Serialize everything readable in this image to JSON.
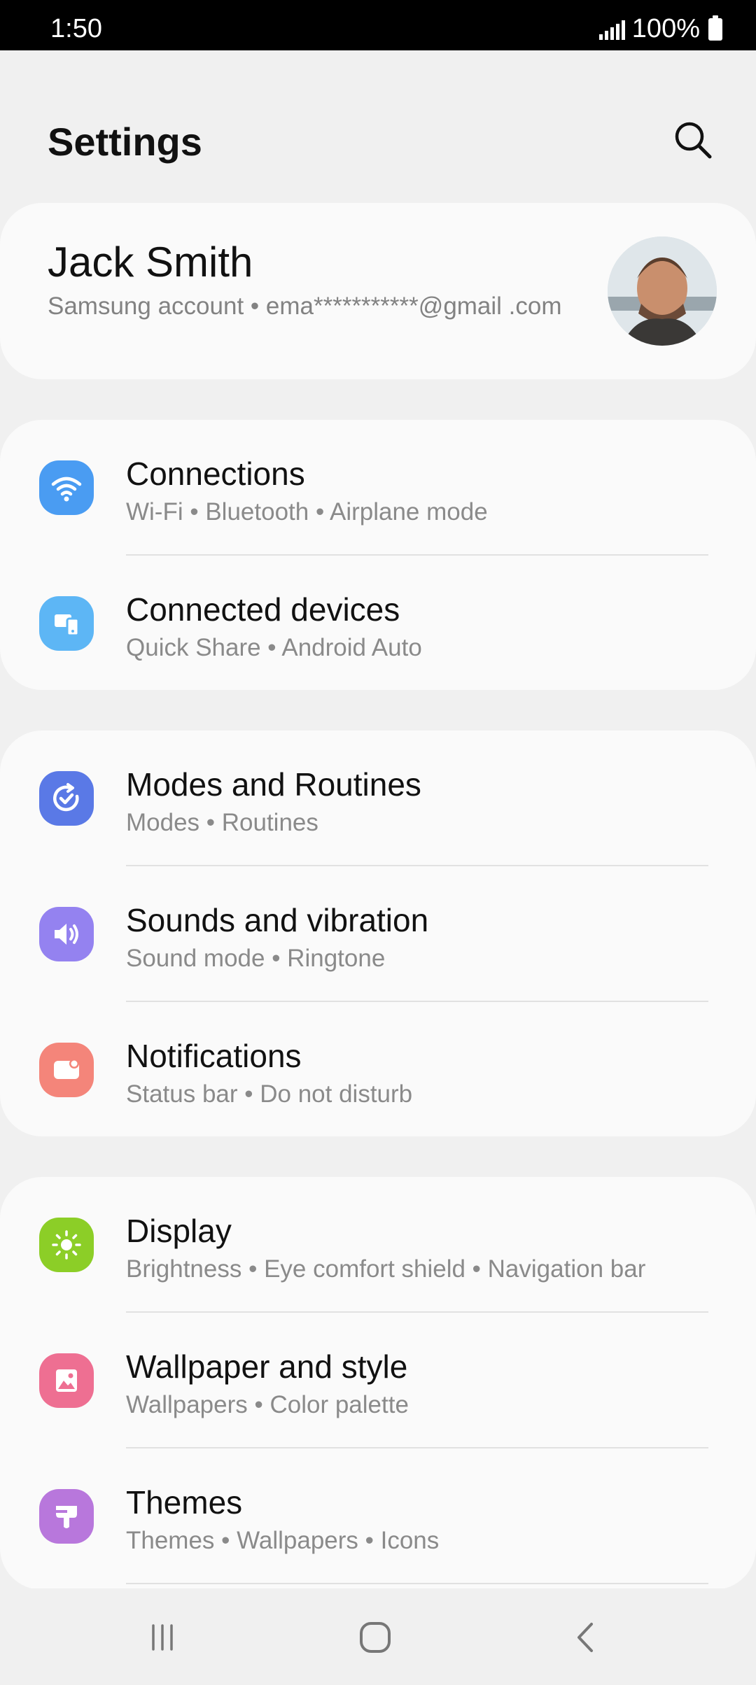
{
  "status_bar": {
    "time": "1:50",
    "battery": "100%"
  },
  "header": {
    "title": "Settings"
  },
  "account": {
    "name": "Jack Smith",
    "subtitle": "Samsung account • ema***********@gmail .com"
  },
  "groups": [
    {
      "items": [
        {
          "title": "Connections",
          "subtitle": "Wi-Fi • Bluetooth • Airplane mode",
          "icon": "wifi-icon",
          "color": "#4a9cf2"
        },
        {
          "title": "Connected devices",
          "subtitle": "Quick Share • Android Auto",
          "icon": "devices-icon",
          "color": "#5db6f5"
        }
      ]
    },
    {
      "items": [
        {
          "title": "Modes and Routines",
          "subtitle": "Modes • Routines",
          "icon": "routines-icon",
          "color": "#5a79e6"
        },
        {
          "title": "Sounds and vibration",
          "subtitle": "Sound mode • Ringtone",
          "icon": "speaker-icon",
          "color": "#9482f0"
        },
        {
          "title": "Notifications",
          "subtitle": "Status bar • Do not disturb",
          "icon": "notification-icon",
          "color": "#f4857a"
        }
      ]
    },
    {
      "items": [
        {
          "title": "Display",
          "subtitle": "Brightness • Eye comfort shield • Navigation bar",
          "icon": "sun-icon",
          "color": "#8cce27"
        },
        {
          "title": "Wallpaper and style",
          "subtitle": "Wallpapers • Color palette",
          "icon": "image-icon",
          "color": "#ee6f92"
        },
        {
          "title": "Themes",
          "subtitle": "Themes • Wallpapers • Icons",
          "icon": "brush-icon",
          "color": "#b877dc"
        }
      ]
    }
  ]
}
